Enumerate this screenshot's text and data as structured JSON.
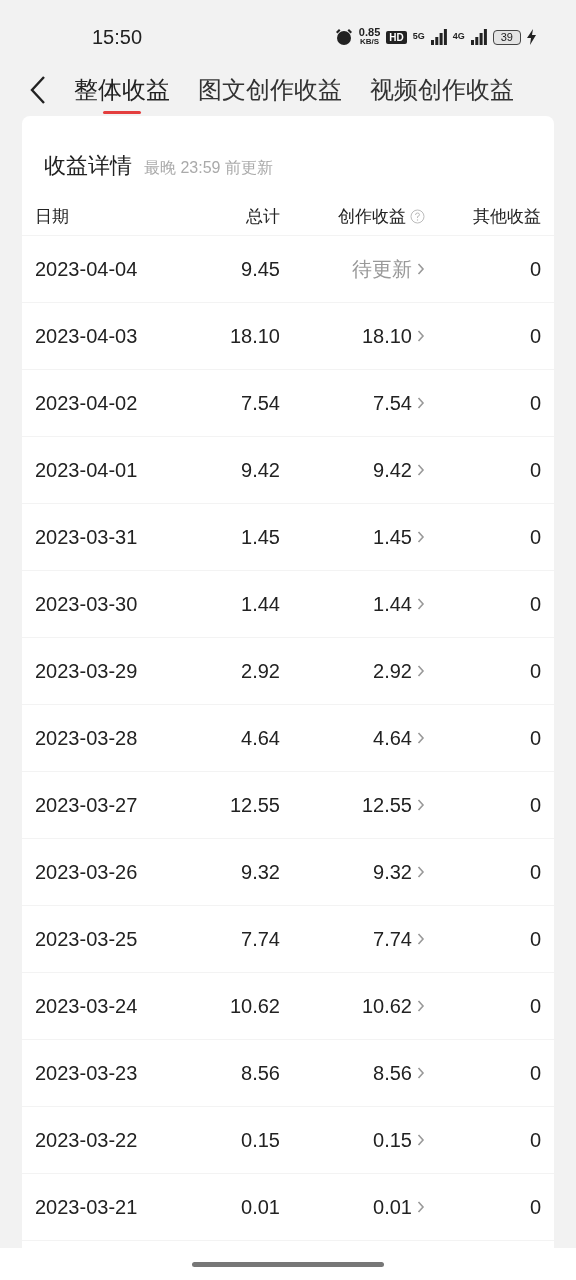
{
  "status_bar": {
    "time": "15:50",
    "speed_value": "0.85",
    "speed_unit": "KB/S",
    "hd": "HD",
    "network_1": "5G",
    "network_2": "4G",
    "battery": "39"
  },
  "tabs": [
    {
      "label": "整体收益",
      "selected": true
    },
    {
      "label": "图文创作收益",
      "selected": false
    },
    {
      "label": "视频创作收益",
      "selected": false
    }
  ],
  "card": {
    "title": "收益详情",
    "subtitle": "最晚 23:59 前更新",
    "columns": [
      "日期",
      "总计",
      "创作收益",
      "其他收益"
    ],
    "rows": [
      {
        "date": "2023-04-04",
        "total": "9.45",
        "creation": "待更新",
        "pending": true,
        "other": "0"
      },
      {
        "date": "2023-04-03",
        "total": "18.10",
        "creation": "18.10",
        "pending": false,
        "other": "0"
      },
      {
        "date": "2023-04-02",
        "total": "7.54",
        "creation": "7.54",
        "pending": false,
        "other": "0"
      },
      {
        "date": "2023-04-01",
        "total": "9.42",
        "creation": "9.42",
        "pending": false,
        "other": "0"
      },
      {
        "date": "2023-03-31",
        "total": "1.45",
        "creation": "1.45",
        "pending": false,
        "other": "0"
      },
      {
        "date": "2023-03-30",
        "total": "1.44",
        "creation": "1.44",
        "pending": false,
        "other": "0"
      },
      {
        "date": "2023-03-29",
        "total": "2.92",
        "creation": "2.92",
        "pending": false,
        "other": "0"
      },
      {
        "date": "2023-03-28",
        "total": "4.64",
        "creation": "4.64",
        "pending": false,
        "other": "0"
      },
      {
        "date": "2023-03-27",
        "total": "12.55",
        "creation": "12.55",
        "pending": false,
        "other": "0"
      },
      {
        "date": "2023-03-26",
        "total": "9.32",
        "creation": "9.32",
        "pending": false,
        "other": "0"
      },
      {
        "date": "2023-03-25",
        "total": "7.74",
        "creation": "7.74",
        "pending": false,
        "other": "0"
      },
      {
        "date": "2023-03-24",
        "total": "10.62",
        "creation": "10.62",
        "pending": false,
        "other": "0"
      },
      {
        "date": "2023-03-23",
        "total": "8.56",
        "creation": "8.56",
        "pending": false,
        "other": "0"
      },
      {
        "date": "2023-03-22",
        "total": "0.15",
        "creation": "0.15",
        "pending": false,
        "other": "0"
      },
      {
        "date": "2023-03-21",
        "total": "0.01",
        "creation": "0.01",
        "pending": false,
        "other": "0"
      }
    ]
  }
}
